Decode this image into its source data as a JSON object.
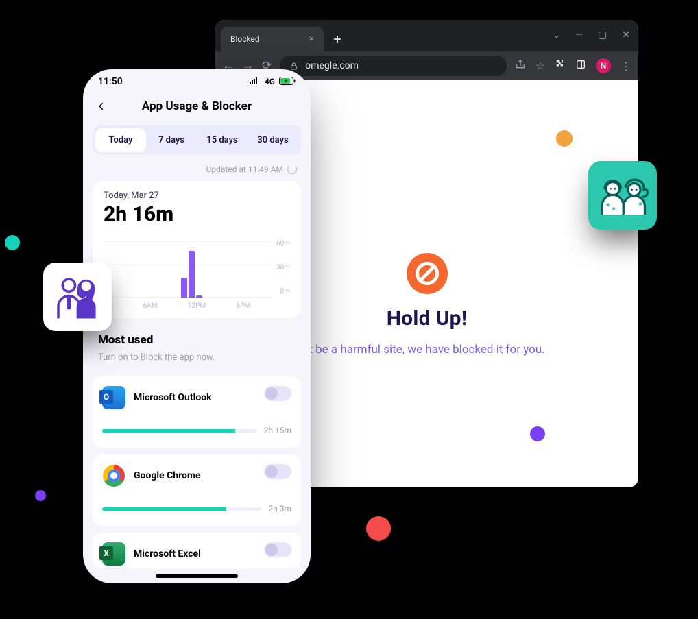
{
  "browser": {
    "tab_title": "Blocked",
    "url": "omegle.com",
    "profile_initial": "N",
    "page": {
      "title": "Hold Up!",
      "subtitle": "t be a harmful site, we have blocked it for you."
    }
  },
  "phone": {
    "statusbar": {
      "time": "11:50",
      "network": "4G"
    },
    "header_title": "App Usage & Blocker",
    "range_tabs": [
      "Today",
      "7 days",
      "15 days",
      "30 days"
    ],
    "updated_text": "Updated at 11:49 AM",
    "usage": {
      "date_label": "Today,  Mar 27",
      "total": "2h 16m"
    },
    "most_used": {
      "title": "Most used",
      "subtitle": "Turn on to Block the app now."
    },
    "apps": [
      {
        "name": "Microsoft Outlook",
        "duration": "2h 15m",
        "bar_pct": 86
      },
      {
        "name": "Google Chrome",
        "duration": "2h 3m",
        "bar_pct": 78
      },
      {
        "name": "Microsoft Excel",
        "duration": "",
        "bar_pct": 0
      }
    ]
  },
  "chart_data": {
    "type": "bar",
    "title": "App usage by time of day",
    "xlabel": "",
    "ylabel": "",
    "y_ticks": [
      "60m",
      "30m",
      "0m"
    ],
    "x_ticks": [
      "6AM",
      "12PM",
      "6PM"
    ],
    "ylim": [
      0,
      60
    ],
    "categories_hours": [
      0,
      1,
      2,
      3,
      4,
      5,
      6,
      7,
      8,
      9,
      10,
      11,
      12,
      13,
      14,
      15,
      16,
      17,
      18,
      19,
      20,
      21,
      22,
      23
    ],
    "values_minutes": [
      0,
      0,
      0,
      0,
      0,
      0,
      0,
      0,
      0,
      0,
      26,
      60,
      3,
      0,
      0,
      0,
      0,
      0,
      0,
      0,
      0,
      0,
      0,
      0
    ]
  }
}
